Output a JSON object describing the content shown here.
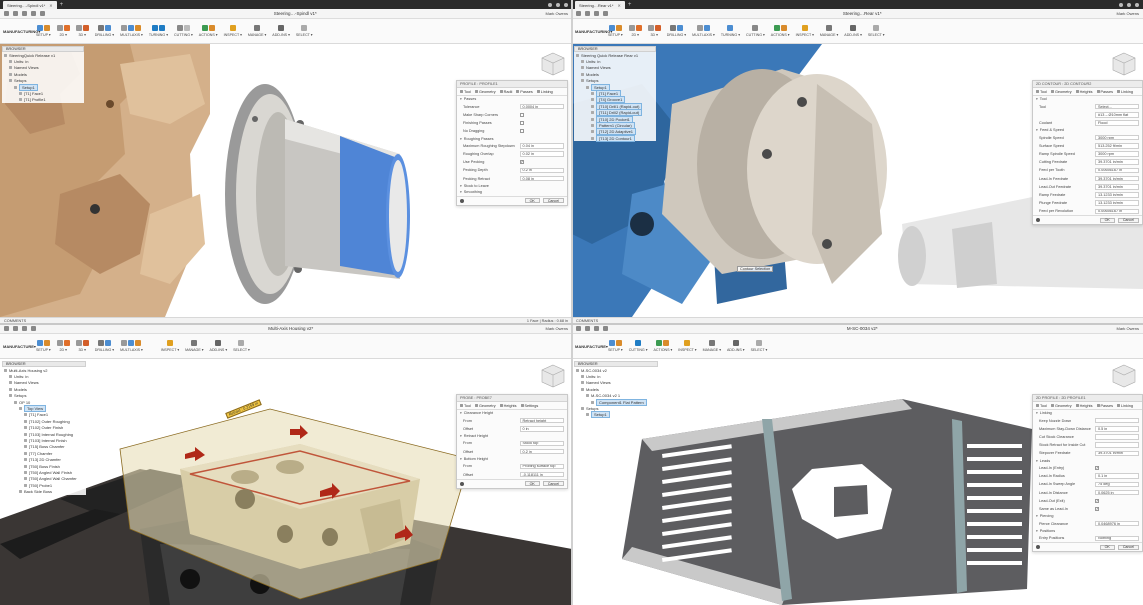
{
  "q1": {
    "window_tab": "Steering…-Spindl v1*",
    "doc_title": "",
    "user": "Mark Owens",
    "workspace": "MANUFACTURING",
    "ribbon": [
      {
        "label": "SETUP ▾"
      },
      {
        "label": "2D ▾"
      },
      {
        "label": "3D ▾"
      },
      {
        "label": "DRILLING ▾"
      },
      {
        "label": "MULTI-AXIS ▾"
      },
      {
        "label": "TURNING ▾"
      },
      {
        "label": "CUTTING ▾"
      },
      {
        "label": "ACTIONS ▾"
      },
      {
        "label": "INSPECT ▾"
      },
      {
        "label": "MANAGE ▾"
      },
      {
        "label": "ADD-INS ▾"
      },
      {
        "label": "SELECT ▾"
      }
    ],
    "browser": {
      "header": "BROWSER",
      "rows": [
        {
          "label": "SteeringQuick Release v1",
          "indent": 0,
          "hl": false
        },
        {
          "label": "Units: in",
          "indent": 1,
          "hl": false
        },
        {
          "label": "Named Views",
          "indent": 1,
          "hl": false
        },
        {
          "label": "Models",
          "indent": 1,
          "hl": false
        },
        {
          "label": "Setups",
          "indent": 1,
          "hl": false
        },
        {
          "label": "Setup1",
          "indent": 2,
          "hl": true
        },
        {
          "label": "[T1] Face1",
          "indent": 3,
          "hl": false
        },
        {
          "label": "[T1] Profile1",
          "indent": 3,
          "hl": false
        }
      ]
    },
    "dialog": {
      "title": "PROFILE : PROFILE1",
      "tabs": [
        "Tool",
        "Geometry",
        "Radii",
        "Passes",
        "Linking"
      ],
      "sections": [
        {
          "type": "sec",
          "label": "Passes"
        },
        {
          "type": "field",
          "k": "Tolerance",
          "v": "0.0004 in"
        },
        {
          "type": "check",
          "k": "Make Sharp Corners",
          "v": ""
        },
        {
          "type": "check",
          "k": "Finishing Passes",
          "v": ""
        },
        {
          "type": "check",
          "k": "No Dragging",
          "v": ""
        },
        {
          "type": "sec",
          "label": "Roughing Passes"
        },
        {
          "type": "field",
          "k": "Maximum Roughing Stepdown",
          "v": "0.04 in"
        },
        {
          "type": "field",
          "k": "Roughing Overlap",
          "v": "0.02 in"
        },
        {
          "type": "check",
          "k": "Use Pecking",
          "v": "✓"
        },
        {
          "type": "field",
          "k": "Pecking Depth",
          "v": "0.2 in"
        },
        {
          "type": "field",
          "k": "Pecking Retract",
          "v": "0.08 in"
        },
        {
          "type": "sec",
          "label": "Stock to Leave"
        },
        {
          "type": "sec",
          "label": "Smoothing"
        }
      ],
      "ok": "OK",
      "cancel": "Cancel"
    },
    "status": {
      "left": "COMMENTS",
      "right": "1 Face | Radius : 0.68 in"
    },
    "colors": {
      "wood": "#d8b58a",
      "accent": "#4a7fd3"
    }
  },
  "q2": {
    "window_tab": "Steering…Rear v1*",
    "user": "Mark Owens",
    "workspace": "MANUFACTURING",
    "ribbon": [
      {
        "label": "SETUP ▾"
      },
      {
        "label": "2D ▾"
      },
      {
        "label": "3D ▾"
      },
      {
        "label": "DRILLING ▾"
      },
      {
        "label": "MULTI-AXIS ▾"
      },
      {
        "label": "TURNING ▾"
      },
      {
        "label": "CUTTING ▾"
      },
      {
        "label": "ACTIONS ▾"
      },
      {
        "label": "INSPECT ▾"
      },
      {
        "label": "MANAGE ▾"
      },
      {
        "label": "ADD-INS ▾"
      },
      {
        "label": "SELECT ▾"
      }
    ],
    "browser": {
      "header": "BROWSER",
      "rows": [
        {
          "label": "Steering Quick Release Rear v1",
          "indent": 0,
          "hl": false
        },
        {
          "label": "Units: in",
          "indent": 1,
          "hl": false
        },
        {
          "label": "Named Views",
          "indent": 1,
          "hl": false
        },
        {
          "label": "Models",
          "indent": 1,
          "hl": false
        },
        {
          "label": "Setups",
          "indent": 1,
          "hl": false
        },
        {
          "label": "Setup1",
          "indent": 2,
          "hl": true
        },
        {
          "label": "[T1] Face1",
          "indent": 3,
          "hl": true
        },
        {
          "label": "[T4] Groove1",
          "indent": 3,
          "hl": true
        },
        {
          "label": "[T10] Drill1 (Rapid-out)",
          "indent": 3,
          "hl": true
        },
        {
          "label": "[T11] Drill2 (Rapid-out)",
          "indent": 3,
          "hl": true
        },
        {
          "label": "[T10] 2D Pocket1",
          "indent": 3,
          "hl": true
        },
        {
          "label": "Pattern1 (Circular)",
          "indent": 3,
          "hl": true
        },
        {
          "label": "[T12] 2D Adaptive1",
          "indent": 3,
          "hl": true
        },
        {
          "label": "[T13] 2D Contour1",
          "indent": 3,
          "hl": true
        }
      ]
    },
    "dialog": {
      "title": "2D CONTOUR : 2D CONTOUR2",
      "tabs": [
        "Tool",
        "Geometry",
        "Heights",
        "Passes",
        "Linking"
      ],
      "sections": [
        {
          "type": "sec",
          "label": "Tool"
        },
        {
          "type": "field",
          "k": "Tool",
          "v": "Select..."
        },
        {
          "type": "field",
          "k": "",
          "v": "#13 – Ø10mm flat"
        },
        {
          "type": "field",
          "k": "Coolant",
          "v": "Flood"
        },
        {
          "type": "sec",
          "label": "Feed & Speed"
        },
        {
          "type": "field",
          "k": "Spindle Speed",
          "v": "3000 rpm"
        },
        {
          "type": "field",
          "k": "Surface Speed",
          "v": "513.252 ft/min"
        },
        {
          "type": "field",
          "k": "Ramp Spindle Speed",
          "v": "3000 rpm"
        },
        {
          "type": "field",
          "k": "Cutting Feedrate",
          "v": "39.3701 in/min"
        },
        {
          "type": "field",
          "k": "Feed per Tooth",
          "v": "0.00656167 in"
        },
        {
          "type": "field",
          "k": "Lead-In Feedrate",
          "v": "39.3701 in/min"
        },
        {
          "type": "field",
          "k": "Lead-Out Feedrate",
          "v": "39.3701 in/min"
        },
        {
          "type": "field",
          "k": "Ramp Feedrate",
          "v": "13.1233 in/min"
        },
        {
          "type": "field",
          "k": "Plunge Feedrate",
          "v": "13.1233 in/min"
        },
        {
          "type": "field",
          "k": "Feed per Revolution",
          "v": "0.00656167 in"
        }
      ],
      "ok": "OK",
      "cancel": "Cancel"
    },
    "contour_label": "Contour Selection",
    "status": {
      "left": "COMMENTS",
      "right": ""
    },
    "colors": {
      "fixture": "#3a77b5",
      "part": "#cfc8bd"
    }
  },
  "q3": {
    "window_tab": "Multi-Axis Housing v2*",
    "user": "Mark Owens",
    "workspace": "MANUFACTURE",
    "ribbon": [
      {
        "label": "SETUP ▾"
      },
      {
        "label": "2D ▾"
      },
      {
        "label": "3D ▾"
      },
      {
        "label": "DRILLING ▾"
      },
      {
        "label": "MULTI-AXIS ▾"
      },
      {
        "label": "INSPECT ▾"
      },
      {
        "label": "MANAGE ▾"
      },
      {
        "label": "ADD-INS ▾"
      },
      {
        "label": "SELECT ▾"
      }
    ],
    "browser": {
      "header": "BROWSER",
      "rows": [
        {
          "label": "Multi-Axis Housing v2",
          "indent": 0,
          "hl": false
        },
        {
          "label": "Units: in",
          "indent": 1,
          "hl": false
        },
        {
          "label": "Named Views",
          "indent": 1,
          "hl": false
        },
        {
          "label": "Models",
          "indent": 1,
          "hl": false
        },
        {
          "label": "Setups",
          "indent": 1,
          "hl": false
        },
        {
          "label": "OP 10",
          "indent": 2,
          "hl": false
        },
        {
          "label": "Top View",
          "indent": 3,
          "hl": true
        },
        {
          "label": "[T1] Face1",
          "indent": 4,
          "hl": false
        },
        {
          "label": "[T102] Outer Roughing",
          "indent": 4,
          "hl": false
        },
        {
          "label": "[T102] Outer Finish",
          "indent": 4,
          "hl": false
        },
        {
          "label": "[T103] Internal Roughing",
          "indent": 4,
          "hl": false
        },
        {
          "label": "[T103] Internal Finish",
          "indent": 4,
          "hl": false
        },
        {
          "label": "[T15] Boss Chamfer",
          "indent": 4,
          "hl": false
        },
        {
          "label": "[T7] Chamfer",
          "indent": 4,
          "hl": false
        },
        {
          "label": "[T13] 2D Chamfer",
          "indent": 4,
          "hl": false
        },
        {
          "label": "[T50] Boss Finish",
          "indent": 4,
          "hl": false
        },
        {
          "label": "[T50] Angled Wall Finish",
          "indent": 4,
          "hl": false
        },
        {
          "label": "[T50] Angled Wall Chamfer",
          "indent": 4,
          "hl": false
        },
        {
          "label": "[T50] Probe1",
          "indent": 4,
          "hl": false
        },
        {
          "label": "Back Side Boss",
          "indent": 3,
          "hl": false
        }
      ]
    },
    "dialog": {
      "title": "PROBE : PROBE7",
      "tabs": [
        "Tool",
        "Geometry",
        "Heights",
        "Settings"
      ],
      "sections": [
        {
          "type": "sec",
          "label": "Clearance Height"
        },
        {
          "type": "field",
          "k": "From",
          "v": "Retract height"
        },
        {
          "type": "field",
          "k": "Offset",
          "v": "0 in"
        },
        {
          "type": "sec",
          "label": "Retract Height"
        },
        {
          "type": "field",
          "k": "From",
          "v": "Stock top"
        },
        {
          "type": "field",
          "k": "Offset",
          "v": "0.2 in"
        },
        {
          "type": "sec",
          "label": "Bottom Height"
        },
        {
          "type": "field",
          "k": "From",
          "v": "Probing surface top"
        },
        {
          "type": "field",
          "k": "Offset",
          "v": "-0.118111 in"
        }
      ],
      "ok": "OK",
      "cancel": "Cancel"
    },
    "measure": "Retract : 0.2159 in",
    "colors": {
      "part": "#d8cda7",
      "vise": "#2a2a2a"
    }
  },
  "q4": {
    "window_tab": "M-SC-0034 v2*",
    "user": "Mark Owens",
    "workspace": "MANUFACTURE",
    "ribbon": [
      {
        "label": "SETUP ▾"
      },
      {
        "label": "CUTTING ▾"
      },
      {
        "label": "ACTIONS ▾"
      },
      {
        "label": "INSPECT ▾"
      },
      {
        "label": "MANAGE ▾"
      },
      {
        "label": "ADD-INS ▾"
      },
      {
        "label": "SELECT ▾"
      }
    ],
    "browser": {
      "header": "BROWSER",
      "rows": [
        {
          "label": "M-SC-0034 v2",
          "indent": 0,
          "hl": false
        },
        {
          "label": "Units: in",
          "indent": 1,
          "hl": false
        },
        {
          "label": "Named Views",
          "indent": 1,
          "hl": false
        },
        {
          "label": "Models",
          "indent": 1,
          "hl": false
        },
        {
          "label": "M-SC-0034 v2 1",
          "indent": 2,
          "hl": false
        },
        {
          "label": "Component1 Flat Pattern",
          "indent": 3,
          "hl": true
        },
        {
          "label": "Setups",
          "indent": 1,
          "hl": false
        },
        {
          "label": "Setup1",
          "indent": 2,
          "hl": true
        }
      ]
    },
    "dialog": {
      "title": "2D PROFILE : 2D PROFILE1",
      "tabs": [
        "Tool",
        "Geometry",
        "Heights",
        "Passes",
        "Linking"
      ],
      "sections": [
        {
          "type": "sec",
          "label": "Linking"
        },
        {
          "type": "field",
          "k": "Keep Nozzle Down",
          "v": ""
        },
        {
          "type": "field",
          "k": "Maximum Stay-Down Distance",
          "v": "0.5 in"
        },
        {
          "type": "field",
          "k": "Cut Stock Clearance",
          "v": ""
        },
        {
          "type": "field",
          "k": "Stock Retract for Inside Cut",
          "v": ""
        },
        {
          "type": "field",
          "k": "Stepover Feedrate",
          "v": "39.3701 in/min"
        },
        {
          "type": "sec",
          "label": "Leads"
        },
        {
          "type": "check",
          "k": "Lead-In (Entry)",
          "v": "✓"
        },
        {
          "type": "field",
          "k": "Lead-In Radius",
          "v": "0.1 in"
        },
        {
          "type": "field",
          "k": "Lead-In Sweep Angle",
          "v": "75 deg"
        },
        {
          "type": "field",
          "k": "Lead-In Distance",
          "v": "0.0625 in"
        },
        {
          "type": "check",
          "k": "Lead-Out (Exit)",
          "v": "✓"
        },
        {
          "type": "check",
          "k": "Same as Lead-In",
          "v": "✓"
        },
        {
          "type": "sec",
          "label": "Piercing"
        },
        {
          "type": "field",
          "k": "Pierce Clearance",
          "v": "0.0468976 in"
        },
        {
          "type": "sec",
          "label": "Positions"
        },
        {
          "type": "field",
          "k": "Entry Positions",
          "v": "Nothing"
        }
      ],
      "ok": "OK",
      "cancel": "Cancel"
    },
    "colors": {
      "sheet": "#5d5d60",
      "rails": "#c9c9c9"
    }
  }
}
